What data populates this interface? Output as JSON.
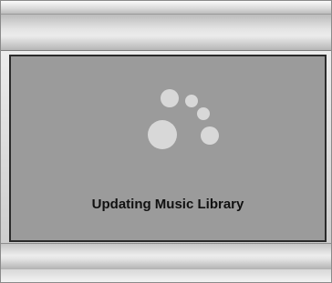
{
  "dialog": {
    "status_text": "Updating Music Library",
    "logo_icon": "music-library-logo-icon"
  },
  "colors": {
    "panel_background": "#9b9b9b",
    "logo_circles": "#d8d8d8",
    "text": "#111111"
  }
}
